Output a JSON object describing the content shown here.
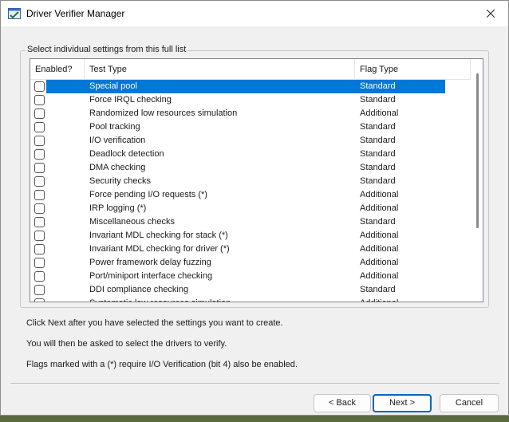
{
  "window": {
    "title": "Driver Verifier Manager"
  },
  "group": {
    "label": "Select individual settings from this full list"
  },
  "table": {
    "columns": [
      "Enabled?",
      "Test Type",
      "Flag Type"
    ],
    "rows": [
      {
        "test": "Special pool",
        "flag": "Standard",
        "enabled": false,
        "selected": true
      },
      {
        "test": "Force IRQL checking",
        "flag": "Standard",
        "enabled": false
      },
      {
        "test": "Randomized low resources simulation",
        "flag": "Additional",
        "enabled": false
      },
      {
        "test": "Pool tracking",
        "flag": "Standard",
        "enabled": false
      },
      {
        "test": "I/O verification",
        "flag": "Standard",
        "enabled": false
      },
      {
        "test": "Deadlock detection",
        "flag": "Standard",
        "enabled": false
      },
      {
        "test": "DMA checking",
        "flag": "Standard",
        "enabled": false
      },
      {
        "test": "Security checks",
        "flag": "Standard",
        "enabled": false
      },
      {
        "test": "Force pending I/O requests (*)",
        "flag": "Additional",
        "enabled": false
      },
      {
        "test": "IRP logging (*)",
        "flag": "Additional",
        "enabled": false
      },
      {
        "test": "Miscellaneous checks",
        "flag": "Standard",
        "enabled": false
      },
      {
        "test": "Invariant MDL checking for stack (*)",
        "flag": "Additional",
        "enabled": false
      },
      {
        "test": "Invariant MDL checking for driver (*)",
        "flag": "Additional",
        "enabled": false
      },
      {
        "test": "Power framework delay fuzzing",
        "flag": "Additional",
        "enabled": false
      },
      {
        "test": "Port/miniport interface checking",
        "flag": "Additional",
        "enabled": false
      },
      {
        "test": "DDI compliance checking",
        "flag": "Standard",
        "enabled": false
      },
      {
        "test": "Systematic low resources simulation",
        "flag": "Additional",
        "enabled": false
      }
    ]
  },
  "instructions": {
    "line1": "Click Next after you have selected the settings you want to create.",
    "line2": "You will then be asked to select the drivers to verify.",
    "line3": "Flags marked with a (*) require I/O Verification (bit 4) also be enabled."
  },
  "buttons": {
    "back": "< Back",
    "next": "Next >",
    "cancel": "Cancel"
  },
  "icons": {
    "app": "verifier-app-icon",
    "close": "close-icon"
  },
  "colors": {
    "selection": "#0078d7",
    "primary_border": "#0067c0"
  }
}
